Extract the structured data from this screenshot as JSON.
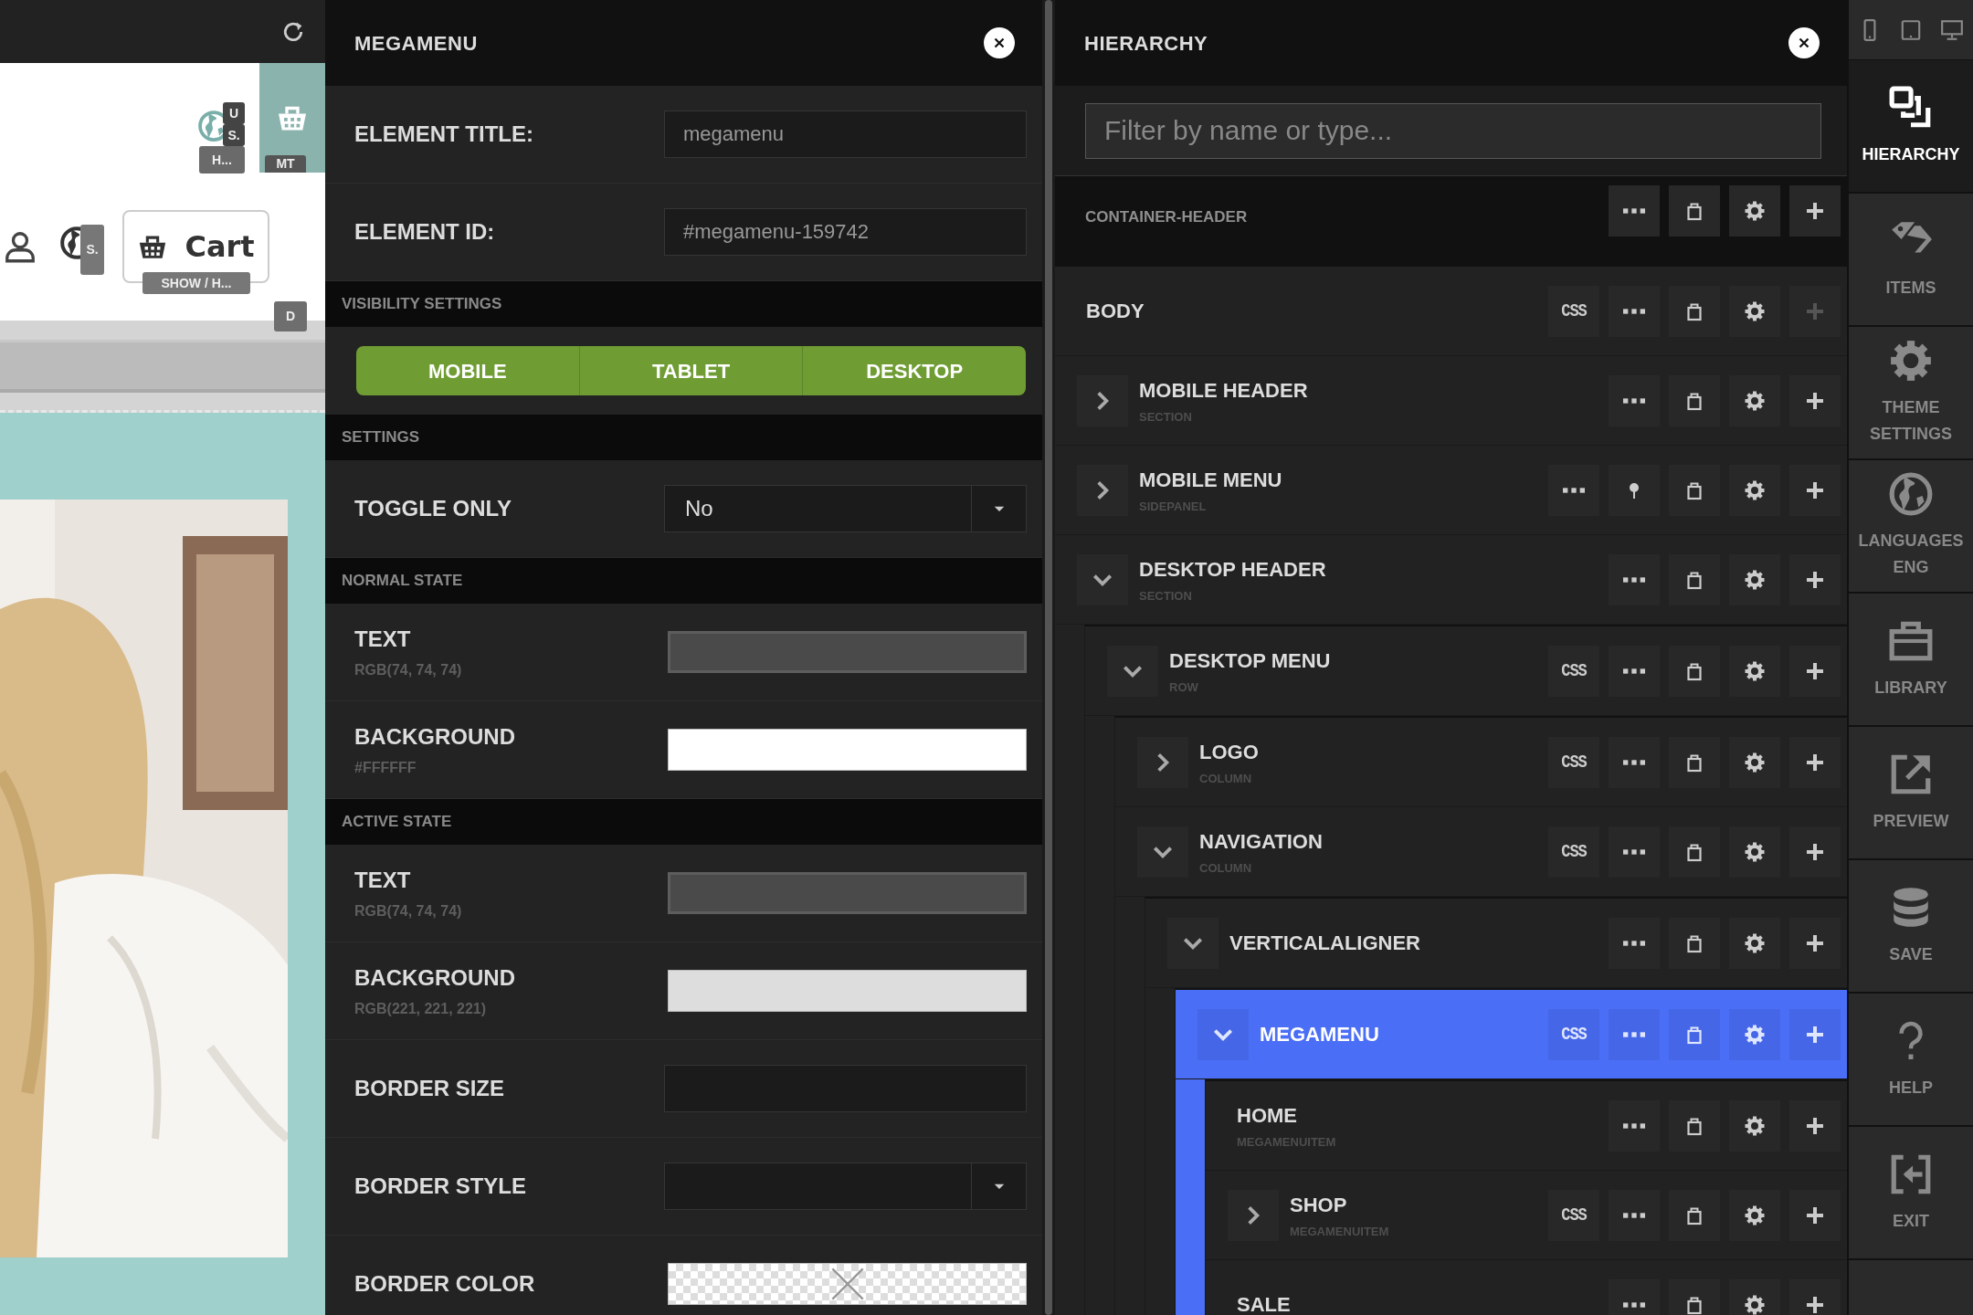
{
  "preview": {
    "badges": [
      "U",
      "S.",
      "H...",
      "MT",
      "S.",
      "SHOW / H...",
      "D"
    ],
    "cart_label": "Cart"
  },
  "megamenu_panel": {
    "title": "MEGAMENU",
    "rows": [
      {
        "kind": "field",
        "label": "ELEMENT TITLE:",
        "value": "megamenu"
      },
      {
        "kind": "field",
        "label": "ELEMENT ID:",
        "value": "#megamenu-159742"
      },
      {
        "kind": "heading",
        "label": "VISIBILITY SETTINGS"
      },
      {
        "kind": "toggles",
        "options": [
          {
            "label": "MOBILE",
            "selected": true
          },
          {
            "label": "TABLET",
            "selected": true
          },
          {
            "label": "DESKTOP",
            "selected": true
          }
        ]
      },
      {
        "kind": "heading",
        "label": "SETTINGS"
      },
      {
        "kind": "select",
        "label": "TOGGLE ONLY",
        "value": "No"
      },
      {
        "kind": "heading",
        "label": "NORMAL STATE"
      },
      {
        "kind": "color",
        "label": "TEXT",
        "note": "RGB(74, 74, 74)",
        "color": "#4a4a4a"
      },
      {
        "kind": "color",
        "label": "BACKGROUND",
        "note": "#FFFFFF",
        "color": "#ffffff"
      },
      {
        "kind": "heading",
        "label": "ACTIVE STATE"
      },
      {
        "kind": "color",
        "label": "TEXT",
        "note": "RGB(74, 74, 74)",
        "color": "#4a4a4a"
      },
      {
        "kind": "color",
        "label": "BACKGROUND",
        "note": "RGB(221, 221, 221)",
        "color": "#dddddd"
      },
      {
        "kind": "field",
        "label": "BORDER SIZE"
      },
      {
        "kind": "select",
        "label": "BORDER STYLE"
      },
      {
        "kind": "color",
        "label": "BORDER COLOR"
      }
    ]
  },
  "hierarchy": {
    "title": "HIERARCHY",
    "filter": {
      "placeholder": "Filter by name or type..."
    },
    "container": {
      "label": "CONTAINER-HEADER",
      "actions": [
        {
          "kind": "more"
        },
        {
          "kind": "delete"
        },
        {
          "kind": "settings"
        },
        {
          "kind": "add"
        }
      ]
    },
    "tree": [
      {
        "name": "BODY",
        "selected": false,
        "actions": [
          {
            "kind": "css",
            "label": "CSS"
          },
          {
            "kind": "more"
          },
          {
            "kind": "delete"
          },
          {
            "kind": "settings"
          },
          {
            "kind": "add-disabled"
          }
        ]
      },
      {
        "name": "MOBILE HEADER",
        "type": "SECTION",
        "expanded": false,
        "selected": false,
        "actions": [
          {
            "kind": "more"
          },
          {
            "kind": "delete"
          },
          {
            "kind": "settings"
          },
          {
            "kind": "add"
          }
        ]
      },
      {
        "name": "MOBILE MENU",
        "type": "SIDEPANEL",
        "expanded": false,
        "selected": false,
        "actions": [
          {
            "kind": "more"
          },
          {
            "kind": "pin"
          },
          {
            "kind": "delete"
          },
          {
            "kind": "settings"
          },
          {
            "kind": "add"
          }
        ]
      },
      {
        "name": "DESKTOP HEADER",
        "type": "SECTION",
        "expanded": true,
        "selected": false,
        "actions": [
          {
            "kind": "more"
          },
          {
            "kind": "delete"
          },
          {
            "kind": "settings"
          },
          {
            "kind": "add"
          }
        ],
        "children": [
          {
            "name": "DESKTOP MENU",
            "type": "ROW",
            "expanded": true,
            "selected": false,
            "actions": [
              {
                "kind": "css",
                "label": "CSS"
              },
              {
                "kind": "more"
              },
              {
                "kind": "delete"
              },
              {
                "kind": "settings"
              },
              {
                "kind": "add"
              }
            ],
            "children": [
              {
                "name": "LOGO",
                "type": "COLUMN",
                "expanded": false,
                "selected": false,
                "actions": [
                  {
                    "kind": "css",
                    "label": "CSS"
                  },
                  {
                    "kind": "more"
                  },
                  {
                    "kind": "delete"
                  },
                  {
                    "kind": "settings"
                  },
                  {
                    "kind": "add"
                  }
                ]
              },
              {
                "name": "NAVIGATION",
                "type": "COLUMN",
                "expanded": true,
                "selected": false,
                "actions": [
                  {
                    "kind": "css",
                    "label": "CSS"
                  },
                  {
                    "kind": "more"
                  },
                  {
                    "kind": "delete"
                  },
                  {
                    "kind": "settings"
                  },
                  {
                    "kind": "add"
                  }
                ],
                "children": [
                  {
                    "name": "VERTICALALIGNER",
                    "expanded": true,
                    "selected": false,
                    "actions": [
                      {
                        "kind": "more"
                      },
                      {
                        "kind": "delete"
                      },
                      {
                        "kind": "settings"
                      },
                      {
                        "kind": "add"
                      }
                    ],
                    "children": [
                      {
                        "name": "MEGAMENU",
                        "expanded": true,
                        "selected": true,
                        "actions": [
                          {
                            "kind": "css",
                            "label": "CSS"
                          },
                          {
                            "kind": "more"
                          },
                          {
                            "kind": "delete"
                          },
                          {
                            "kind": "settings"
                          },
                          {
                            "kind": "add"
                          }
                        ],
                        "children": [
                          {
                            "name": "HOME",
                            "type": "MEGAMENUITEM",
                            "selected": false,
                            "actions": [
                              {
                                "kind": "more"
                              },
                              {
                                "kind": "delete"
                              },
                              {
                                "kind": "settings"
                              },
                              {
                                "kind": "add"
                              }
                            ]
                          },
                          {
                            "name": "SHOP",
                            "type": "MEGAMENUITEM",
                            "expanded": false,
                            "selected": false,
                            "actions": [
                              {
                                "kind": "css",
                                "label": "CSS"
                              },
                              {
                                "kind": "more"
                              },
                              {
                                "kind": "delete"
                              },
                              {
                                "kind": "settings"
                              },
                              {
                                "kind": "add"
                              }
                            ]
                          },
                          {
                            "name": "SALE",
                            "selected": false,
                            "actions": [
                              {
                                "kind": "more"
                              },
                              {
                                "kind": "delete"
                              },
                              {
                                "kind": "settings"
                              },
                              {
                                "kind": "add"
                              }
                            ]
                          }
                        ]
                      }
                    ]
                  }
                ]
              }
            ]
          }
        ]
      }
    ]
  },
  "sidebar": {
    "devices": [
      {
        "kind": "phone"
      },
      {
        "kind": "tablet"
      },
      {
        "kind": "desktop"
      }
    ],
    "items": [
      {
        "kind": "hierarchy",
        "label": "HIERARCHY",
        "selected": true
      },
      {
        "kind": "items",
        "label": "ITEMS",
        "selected": false
      },
      {
        "kind": "settings",
        "label": "THEME SETTINGS",
        "selected": false
      },
      {
        "kind": "languages",
        "label": "LANGUAGES",
        "sublabel": "ENG",
        "selected": false
      },
      {
        "kind": "library",
        "label": "LIBRARY",
        "selected": false
      },
      {
        "kind": "preview",
        "label": "PREVIEW",
        "selected": false
      },
      {
        "kind": "save",
        "label": "SAVE",
        "selected": false
      },
      {
        "kind": "help",
        "label": "HELP",
        "selected": false
      },
      {
        "kind": "exit",
        "label": "EXIT",
        "selected": false
      }
    ]
  }
}
